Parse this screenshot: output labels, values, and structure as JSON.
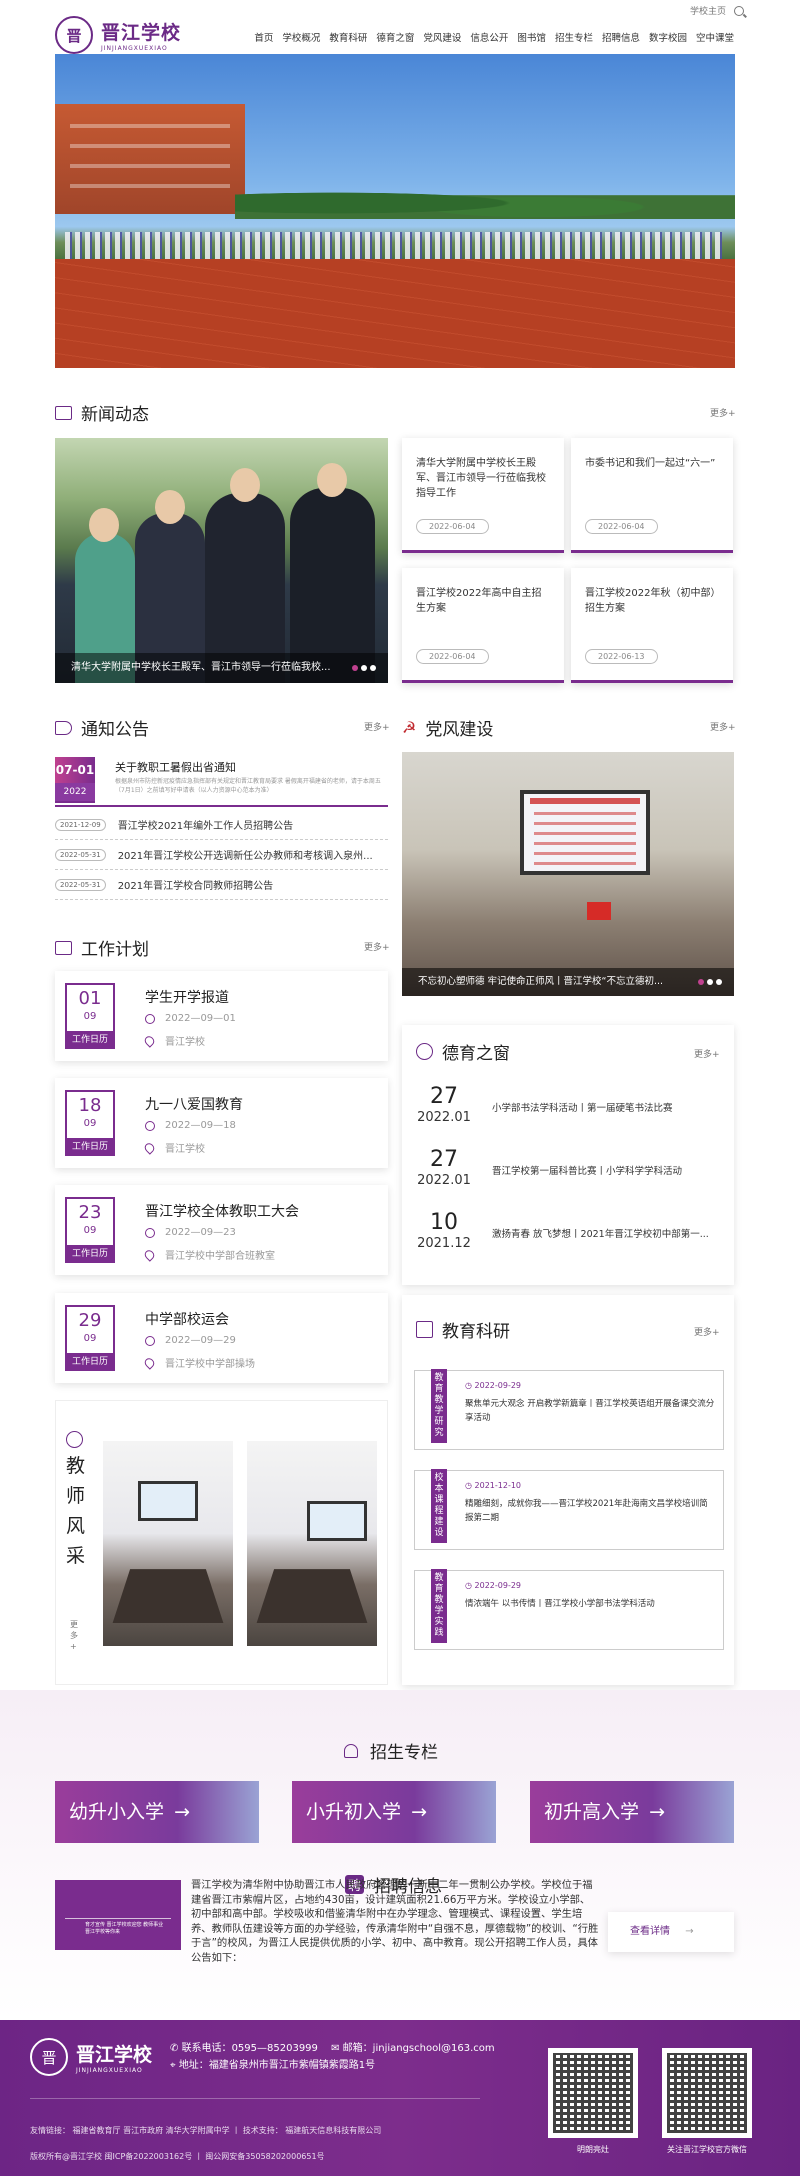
{
  "header": {
    "logo_glyph": "晋",
    "school_name": "晋江学校",
    "school_pinyin": "JINJIANGXUEXIAO",
    "home_link": "学校主页",
    "nav": [
      "首页",
      "学校概况",
      "教育科研",
      "德育之窗",
      "党风建设",
      "信息公开",
      "图书馆",
      "招生专栏",
      "招聘信息",
      "数字校园",
      "空中课堂"
    ]
  },
  "news": {
    "title": "新闻动态",
    "more": "更多+",
    "main_caption": "清华大学附属中学校长王殿军、晋江市领导一行莅临我校...",
    "cards": [
      {
        "title": "清华大学附属中学校长王殿军、晋江市领导一行莅临我校指导工作",
        "date": "2022-06-04"
      },
      {
        "title": "市委书记和我们一起过“六一”",
        "date": "2022-06-04"
      },
      {
        "title": "晋江学校2022年高中自主招生方案",
        "date": "2022-06-04"
      },
      {
        "title": "晋江学校2022年秋（初中部）招生方案",
        "date": "2022-06-13"
      }
    ]
  },
  "notice": {
    "title": "通知公告",
    "more": "更多+",
    "first": {
      "date_md": "07-01",
      "date_y": "2022",
      "title": "关于教职工暑假出省通知",
      "summary": "根据泉州市防控新冠疫情应急指挥部有关规定和晋江教育局要求 暑假离开福建省的老师，请于本周五（7月1日）之前填写好申请表（以人力资源中心范本为准）"
    },
    "rows": [
      {
        "date": "2021-12-09",
        "title": "晋江学校2021年编外工作人员招聘公告"
      },
      {
        "date": "2022-05-31",
        "title": "2021年晋江学校公开选调新任公办教师和考核调入泉州..."
      },
      {
        "date": "2022-05-31",
        "title": "2021年晋江学校合同教师招聘公告"
      }
    ]
  },
  "party": {
    "title": "党风建设",
    "more": "更多+",
    "caption": "不忘初心塑师德 牢记使命正师风丨晋江学校“不忘立德初..."
  },
  "plan": {
    "title": "工作计划",
    "more": "更多+",
    "label": "工作日历",
    "items": [
      {
        "day": "01",
        "month": "09",
        "title": "学生开学报道",
        "date": "2022—09—01",
        "place": "晋江学校"
      },
      {
        "day": "18",
        "month": "09",
        "title": "九一八爱国教育",
        "date": "2022—09—18",
        "place": "晋江学校"
      },
      {
        "day": "23",
        "month": "09",
        "title": "晋江学校全体教职工大会",
        "date": "2022—09—23",
        "place": "晋江学校中学部合班教室"
      },
      {
        "day": "29",
        "month": "09",
        "title": "中学部校运会",
        "date": "2022—09—29",
        "place": "晋江学校中学部操场"
      }
    ]
  },
  "moral": {
    "title": "德育之窗",
    "more": "更多+",
    "items": [
      {
        "day": "27",
        "ym": "2022.01",
        "title": "小学部书法学科活动丨第一届硬笔书法比赛"
      },
      {
        "day": "27",
        "ym": "2022.01",
        "title": "晋江学校第一届科普比赛丨小学科学学科活动"
      },
      {
        "day": "10",
        "ym": "2021.12",
        "title": "激扬青春 放飞梦想丨2021年晋江学校初中部第一..."
      }
    ]
  },
  "research": {
    "title": "教育科研",
    "more": "更多+",
    "items": [
      {
        "tag": "教育教学研究",
        "date": "2022-09-29",
        "title": "聚焦单元大观念 开启教学新篇章丨晋江学校英语组开展备课交流分享活动"
      },
      {
        "tag": "校本课程建设",
        "date": "2021-12-10",
        "title": "精雕细刻，成就你我——晋江学校2021年赴海南文昌学校培训简报第二期"
      },
      {
        "tag": "教育教学实践",
        "date": "2022-09-29",
        "title": "情浓端午 以书传情丨晋江学校小学部书法学科活动"
      }
    ]
  },
  "teacher": {
    "title": "教师风采",
    "more": "更多+"
  },
  "admission": {
    "title": "招生专栏",
    "buttons": [
      {
        "label": "幼升小入学",
        "arrow": "→"
      },
      {
        "label": "小升初入学",
        "arrow": "→"
      },
      {
        "label": "初升高入学",
        "arrow": "→"
      }
    ]
  },
  "recruit": {
    "title": "招聘信息",
    "mark": "聘",
    "image_text": "育才宣传 晋江学校欢迎您 教师事业 晋江学校等你来",
    "text": "晋江学校为清华附中协助晋江市人民政府管理的一所十二年一贯制公办学校。学校位于福建省晋江市紫帽片区，占地约430亩，设计建筑面积21.66万平方米。学校设立小学部、初中部和高中部。学校吸收和借鉴清华附中在办学理念、管理模式、课程设置、学生培养、教师队伍建设等方面的办学经验，传承清华附中“自强不息，厚德载物”的校训、“行胜于言”的校风，为晋江人民提供优质的小学、初中、高中教育。现公开招聘工作人员，具体公告如下：",
    "more": "查看详情"
  },
  "footer": {
    "school_name": "晋江学校",
    "school_pinyin": "JINJIANGXUEXIAO",
    "phone_label": "联系电话：",
    "phone": "0595—85203999",
    "email_label": "邮箱：",
    "email": "jinjiangschool@163.com",
    "address_label": "地址：",
    "address": "福建省泉州市晋江市紫帽镇紫霞路1号",
    "links": "友情链接： 福建省教育厅 晋江市政府 清华大学附属中学 丨 技术支持： 福建航天信息科技有限公司",
    "copyright": "版权所有@晋江学校 闽ICP备2022003162号 丨 闽公网安备35058202000651号",
    "qr1_label": "明朗亮灶",
    "qr2_label": "关注晋江学校官方微信"
  },
  "colors": {
    "brand": "#7a2c8e",
    "accent": "#c0418f"
  }
}
